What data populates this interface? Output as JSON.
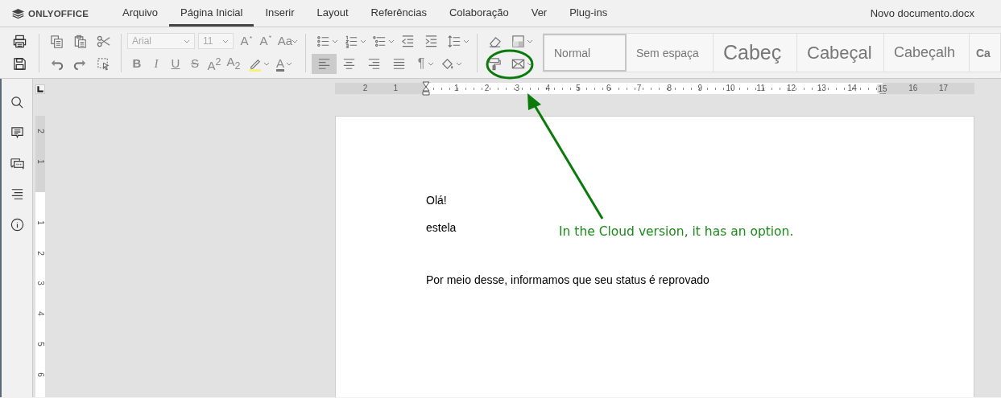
{
  "app": {
    "logo": "ONLYOFFICE",
    "document_title": "Novo documento.docx"
  },
  "tabs": [
    {
      "label": "Arquivo",
      "selected": false
    },
    {
      "label": "Página Inicial",
      "selected": true
    },
    {
      "label": "Inserir",
      "selected": false
    },
    {
      "label": "Layout",
      "selected": false
    },
    {
      "label": "Referências",
      "selected": false
    },
    {
      "label": "Colaboração",
      "selected": false
    },
    {
      "label": "Ver",
      "selected": false
    },
    {
      "label": "Plug-ins",
      "selected": false
    }
  ],
  "toolbar": {
    "font_name": "Arial",
    "font_size": "11",
    "grow_font": "A",
    "shrink_font": "A",
    "change_case": "Aa",
    "bold": "B",
    "italic": "I",
    "underline": "U",
    "strikethrough": "S",
    "superscript": "A$^{2}$",
    "subscript": "A$_{2}$",
    "font_color": "A",
    "paragraph_mark": "¶",
    "alignments": [
      {
        "selected": true
      },
      {
        "selected": false
      },
      {
        "selected": false
      },
      {
        "selected": false
      }
    ]
  },
  "styles": [
    {
      "label": "Normal",
      "selected": true
    },
    {
      "label": "Sem espaça",
      "selected": false
    },
    {
      "label": "Cabeç",
      "selected": false
    },
    {
      "label": "Cabeçal",
      "selected": false
    },
    {
      "label": "Cabeçalh",
      "selected": false
    },
    {
      "label": "Ca",
      "selected": false
    }
  ],
  "rulers": {
    "horizontal": {
      "before": [
        "2",
        "1"
      ],
      "page": [
        "1",
        "2",
        "3",
        "4",
        "5",
        "6",
        "7",
        "8",
        "9",
        "10",
        "11",
        "12",
        "13",
        "14",
        "15"
      ],
      "after": [
        "16",
        "17"
      ]
    },
    "vertical": {
      "before": [
        "2",
        "1"
      ],
      "page": [
        "1",
        "2",
        "3",
        "4",
        "5",
        "6"
      ]
    }
  },
  "document": {
    "paragraphs": [
      "Olá!",
      "estela",
      "Por meio desse, informamos que seu status é reprovado"
    ]
  },
  "annotation": {
    "text": "In the Cloud version, it has an option."
  }
}
